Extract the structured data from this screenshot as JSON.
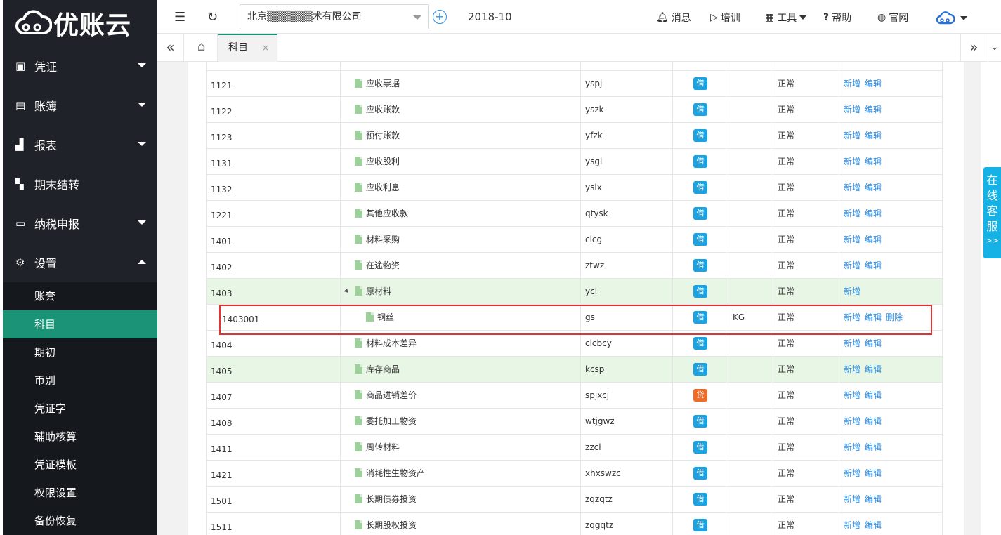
{
  "brand": {
    "name": "优账云"
  },
  "sidebar": {
    "items": [
      {
        "label": "凭证",
        "icon": "voucher-icon",
        "caret": "down"
      },
      {
        "label": "账簿",
        "icon": "ledger-icon",
        "caret": "down"
      },
      {
        "label": "报表",
        "icon": "chart-icon",
        "caret": "down"
      },
      {
        "label": "期末结转",
        "icon": "transfer-icon",
        "caret": ""
      },
      {
        "label": "纳税申报",
        "icon": "tax-icon",
        "caret": "down"
      },
      {
        "label": "设置",
        "icon": "gear-icon",
        "caret": "up"
      }
    ],
    "submenu": [
      "账套",
      "科目",
      "期初",
      "币别",
      "凭证字",
      "辅助核算",
      "凭证模板",
      "权限设置",
      "备份恢复"
    ],
    "active_sub": "科目"
  },
  "header": {
    "company": "北京▒▒▒▒▒▒术有限公司",
    "period": "2018-10",
    "links": {
      "msg": "消息",
      "train": "培训",
      "tools": "工具",
      "help": "帮助",
      "site": "官网"
    }
  },
  "tabs": {
    "active": "科目",
    "close": "×"
  },
  "actions": {
    "add": "新增",
    "edit": "编辑",
    "delete": "删除"
  },
  "rows": [
    {
      "code": "1121",
      "name": "应收票据",
      "mnemonic": "yspj",
      "dir": "借",
      "unit": "",
      "status": "正常",
      "actions": [
        "add",
        "edit"
      ]
    },
    {
      "code": "1122",
      "name": "应收账款",
      "mnemonic": "yszk",
      "dir": "借",
      "unit": "",
      "status": "正常",
      "actions": [
        "add",
        "edit"
      ]
    },
    {
      "code": "1123",
      "name": "预付账款",
      "mnemonic": "yfzk",
      "dir": "借",
      "unit": "",
      "status": "正常",
      "actions": [
        "add",
        "edit"
      ]
    },
    {
      "code": "1131",
      "name": "应收股利",
      "mnemonic": "ysgl",
      "dir": "借",
      "unit": "",
      "status": "正常",
      "actions": [
        "add",
        "edit"
      ]
    },
    {
      "code": "1132",
      "name": "应收利息",
      "mnemonic": "yslx",
      "dir": "借",
      "unit": "",
      "status": "正常",
      "actions": [
        "add",
        "edit"
      ]
    },
    {
      "code": "1221",
      "name": "其他应收款",
      "mnemonic": "qtysk",
      "dir": "借",
      "unit": "",
      "status": "正常",
      "actions": [
        "add",
        "edit"
      ]
    },
    {
      "code": "1401",
      "name": "材料采购",
      "mnemonic": "clcg",
      "dir": "借",
      "unit": "",
      "status": "正常",
      "actions": [
        "add",
        "edit"
      ]
    },
    {
      "code": "1402",
      "name": "在途物资",
      "mnemonic": "ztwz",
      "dir": "借",
      "unit": "",
      "status": "正常",
      "actions": [
        "add",
        "edit"
      ]
    },
    {
      "code": "1403",
      "name": "原材料",
      "mnemonic": "ycl",
      "dir": "借",
      "unit": "",
      "status": "正常",
      "actions": [
        "add"
      ],
      "parent": true,
      "hl": true
    },
    {
      "code": "1403001",
      "name": "钢丝",
      "mnemonic": "gs",
      "dir": "借",
      "unit": "KG",
      "status": "正常",
      "actions": [
        "add",
        "edit",
        "delete"
      ],
      "child": true
    },
    {
      "code": "1404",
      "name": "材料成本差异",
      "mnemonic": "clcbcy",
      "dir": "借",
      "unit": "",
      "status": "正常",
      "actions": [
        "add",
        "edit"
      ]
    },
    {
      "code": "1405",
      "name": "库存商品",
      "mnemonic": "kcsp",
      "dir": "借",
      "unit": "",
      "status": "正常",
      "actions": [
        "add",
        "edit"
      ],
      "hl": true
    },
    {
      "code": "1407",
      "name": "商品进销差价",
      "mnemonic": "spjxcj",
      "dir": "贷",
      "unit": "",
      "status": "正常",
      "actions": [
        "add",
        "edit"
      ]
    },
    {
      "code": "1408",
      "name": "委托加工物资",
      "mnemonic": "wtjgwz",
      "dir": "借",
      "unit": "",
      "status": "正常",
      "actions": [
        "add",
        "edit"
      ]
    },
    {
      "code": "1411",
      "name": "周转材料",
      "mnemonic": "zzcl",
      "dir": "借",
      "unit": "",
      "status": "正常",
      "actions": [
        "add",
        "edit"
      ]
    },
    {
      "code": "1421",
      "name": "消耗性生物资产",
      "mnemonic": "xhxswzc",
      "dir": "借",
      "unit": "",
      "status": "正常",
      "actions": [
        "add",
        "edit"
      ]
    },
    {
      "code": "1501",
      "name": "长期债券投资",
      "mnemonic": "zqzqtz",
      "dir": "借",
      "unit": "",
      "status": "正常",
      "actions": [
        "add",
        "edit"
      ]
    },
    {
      "code": "1511",
      "name": "长期股权投资",
      "mnemonic": "zqgqtz",
      "dir": "借",
      "unit": "",
      "status": "正常",
      "actions": [
        "add",
        "edit"
      ]
    }
  ],
  "float_service": {
    "label": [
      "在",
      "线",
      "客",
      "服"
    ],
    "arrows": ">>"
  }
}
